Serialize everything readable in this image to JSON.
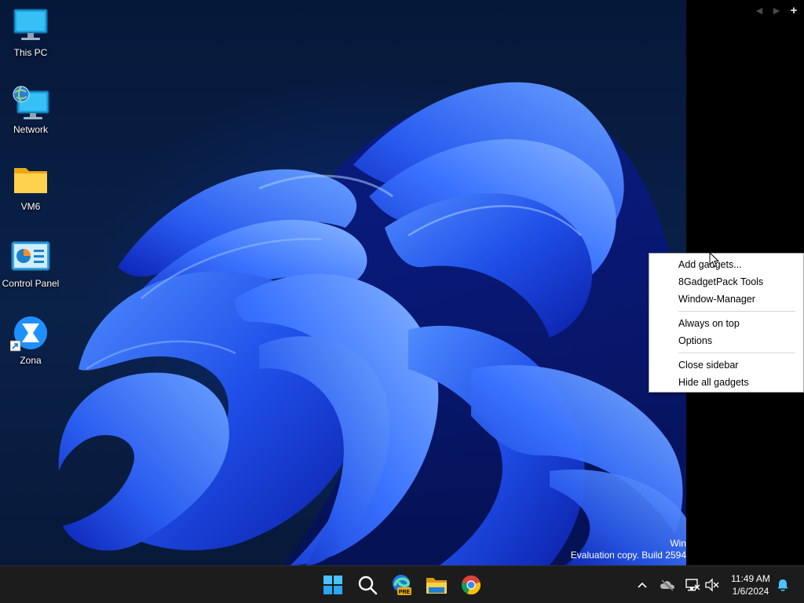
{
  "desktop": {
    "icons": [
      {
        "label": "This PC",
        "icon": "monitor-icon"
      },
      {
        "label": "Network",
        "icon": "network-globe-monitor-icon"
      },
      {
        "label": "VM6",
        "icon": "folder-icon"
      },
      {
        "label": "Control Panel",
        "icon": "control-panel-icon"
      },
      {
        "label": "Zona",
        "icon": "zona-app-shortcut-icon"
      }
    ],
    "watermark": {
      "line1": "Win",
      "line2": "Evaluation copy. Build 2594"
    }
  },
  "sidebar": {
    "controls": {
      "prev": "◀",
      "next": "▶",
      "add": "+"
    }
  },
  "context_menu": {
    "group1": [
      "Add gadgets...",
      "8GadgetPack Tools",
      "Window-Manager"
    ],
    "group2": [
      "Always on top",
      "Options"
    ],
    "group3": [
      "Close sidebar",
      "Hide all gadgets"
    ]
  },
  "taskbar": {
    "apps": [
      {
        "name": "Start",
        "icon": "windows-start-icon"
      },
      {
        "name": "Search",
        "icon": "search-icon"
      },
      {
        "name": "Microsoft Edge Preview",
        "icon": "edge-pre-icon",
        "badge": "PRE"
      },
      {
        "name": "File Explorer",
        "icon": "file-explorer-icon"
      },
      {
        "name": "Google Chrome",
        "icon": "chrome-icon"
      }
    ],
    "tray": {
      "icons": [
        "chevron-up-icon",
        "cloud-offline-icon",
        "network-disconnected-icon",
        "speaker-muted-icon"
      ],
      "time": "11:49 AM",
      "date": "1/6/2024",
      "notification_icon": "bell-icon"
    },
    "colors": {
      "background": "#1c1c1c",
      "accent": "#1e90ff"
    }
  }
}
